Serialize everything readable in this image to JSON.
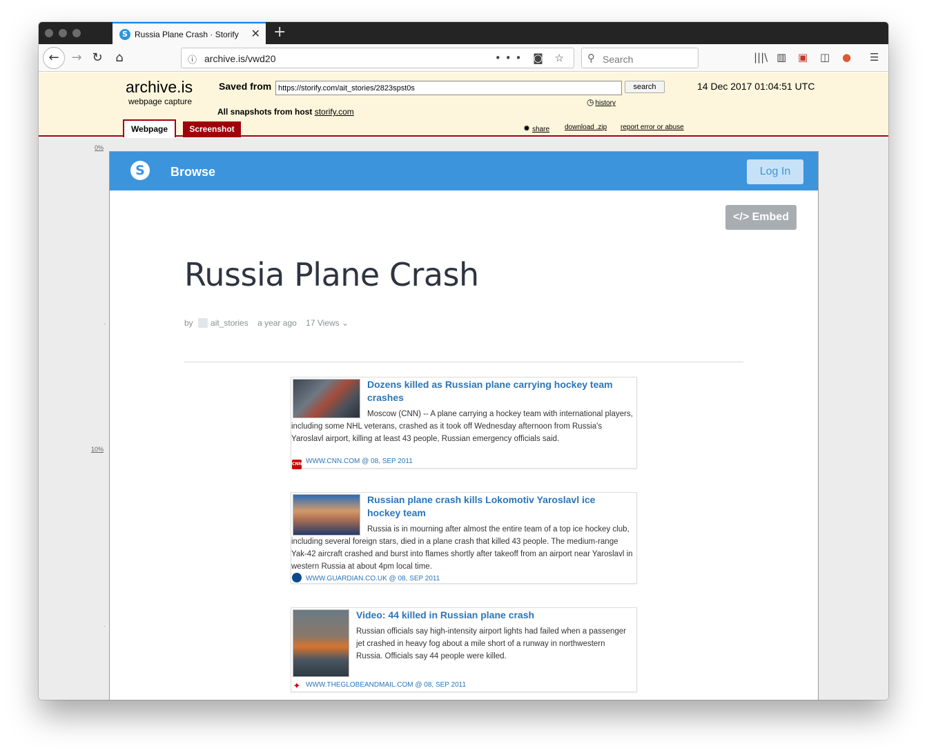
{
  "browser": {
    "tab_title": "Russia Plane Crash · Storify",
    "tab_close": "✕",
    "new_tab": "+",
    "url": "archive.is/vwd20",
    "search_placeholder": "Search"
  },
  "archive": {
    "logo": "archive.is",
    "subtitle": "webpage capture",
    "saved_from_label": "Saved from",
    "saved_from_url": "https://storify.com/ait_stories/2823spst0s",
    "search_button": "search",
    "date": "14 Dec 2017 01:04:51 UTC",
    "history_link": "history",
    "snapshots_label": "All snapshots  from host",
    "snapshots_host": "storify.com",
    "tab_webpage": "Webpage",
    "tab_screenshot": "Screenshot",
    "share": "share",
    "download": "download .zip",
    "report": "report error or abuse",
    "ruler": [
      "0%",
      "10%"
    ]
  },
  "storify": {
    "browse": "Browse",
    "login": "Log In",
    "embed": "Embed",
    "title": "Russia Plane Crash",
    "meta": {
      "by": "by",
      "author": "ait_stories",
      "time": "a year ago",
      "views": "17 Views"
    }
  },
  "cards": [
    {
      "title": "Dozens killed as Russian plane carrying hockey team crashes",
      "text": "Moscow (CNN) -- A plane carrying a hockey team with international players, including some NHL veterans, crashed as it took off Wednesday afternoon from Russia's Yaroslavl airport, killing at least 43 people, Russian emergency officials said.",
      "source": "WWW.CNN.COM @ 08, SEP 2011",
      "source_icon": "cnn-logo-icon",
      "icon_text": "CNN"
    },
    {
      "title": "Russian plane crash kills Lokomotiv Yaroslavl ice hockey team",
      "text": "Russia is in mourning after almost the entire team of a top ice hockey club, including several foreign stars, died in a plane crash that killed 43 people. The medium-range Yak-42 aircraft crashed and burst into flames shortly after takeoff from an airport near Yaroslavl in western Russia at about 4pm local time.",
      "source": "WWW.GUARDIAN.CO.UK @ 08, SEP 2011",
      "source_icon": "guardian-logo-icon"
    },
    {
      "title": "Video: 44 killed in Russian plane crash",
      "text": "Russian officials say high-intensity airport lights had failed when a passenger jet crashed in heavy fog about a mile short of a runway in northwestern Russia. Officials say 44 people were killed.",
      "source": "WWW.THEGLOBEANDMAIL.COM @ 08, SEP 2011",
      "source_icon": "globe-and-mail-maple-leaf-icon"
    }
  ],
  "colors": {
    "storify_blue": "#3c95dc",
    "archive_red": "#a0000a",
    "archive_bg": "#fdf6dc",
    "link_blue": "#2a75b8"
  }
}
